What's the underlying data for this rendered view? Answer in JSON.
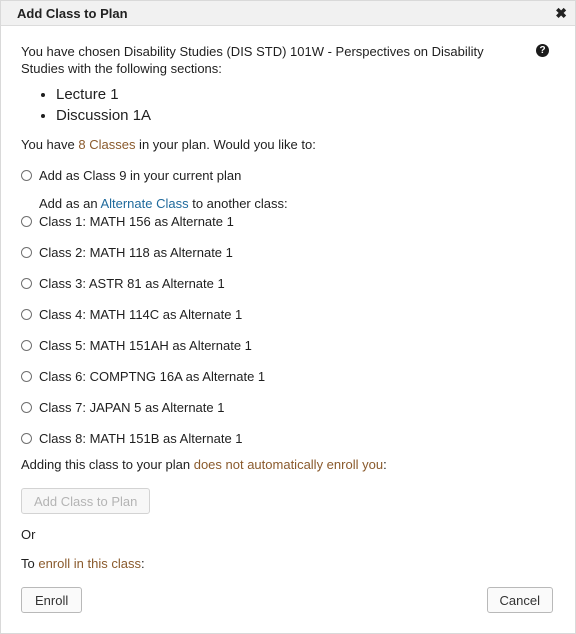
{
  "dialog": {
    "title": "Add Class to Plan",
    "close_icon": "close-icon",
    "help_icon_glyph": "?"
  },
  "intro": {
    "text": "You have chosen Disability Studies (DIS STD) 101W - Perspectives on Disability Studies with the following sections:"
  },
  "sections": [
    "Lecture 1",
    "Discussion 1A"
  ],
  "plan_status": {
    "prefix": "You have ",
    "classes_link": "8 Classes",
    "suffix": " in your plan. Would you like to:"
  },
  "add_option": {
    "label": "Add as Class 9 in your current plan"
  },
  "alternate_intro": {
    "prefix": "Add as an ",
    "link": "Alternate Class",
    "suffix": " to another class:"
  },
  "alternate_options": [
    "Class 1: MATH 156 as Alternate 1",
    "Class 2: MATH 118 as Alternate 1",
    "Class 3: ASTR 81 as Alternate 1",
    "Class 4: MATH 114C as Alternate 1",
    "Class 5: MATH 151AH as Alternate 1",
    "Class 6: COMPTNG 16A as Alternate 1",
    "Class 7: JAPAN 5 as Alternate 1",
    "Class 8: MATH 151B as Alternate 1"
  ],
  "enroll_notice": {
    "prefix": "Adding this class to your plan ",
    "link": "does not automatically enroll you",
    "suffix": ":"
  },
  "buttons": {
    "add_to_plan": "Add Class to Plan",
    "enroll": "Enroll",
    "cancel": "Cancel"
  },
  "or_text": "Or",
  "enroll_line": {
    "prefix": "To ",
    "link": "enroll in this class",
    "suffix": ":"
  },
  "colors": {
    "brown_accent": "#8a5a2c",
    "blue_accent": "#1f6a9c"
  }
}
